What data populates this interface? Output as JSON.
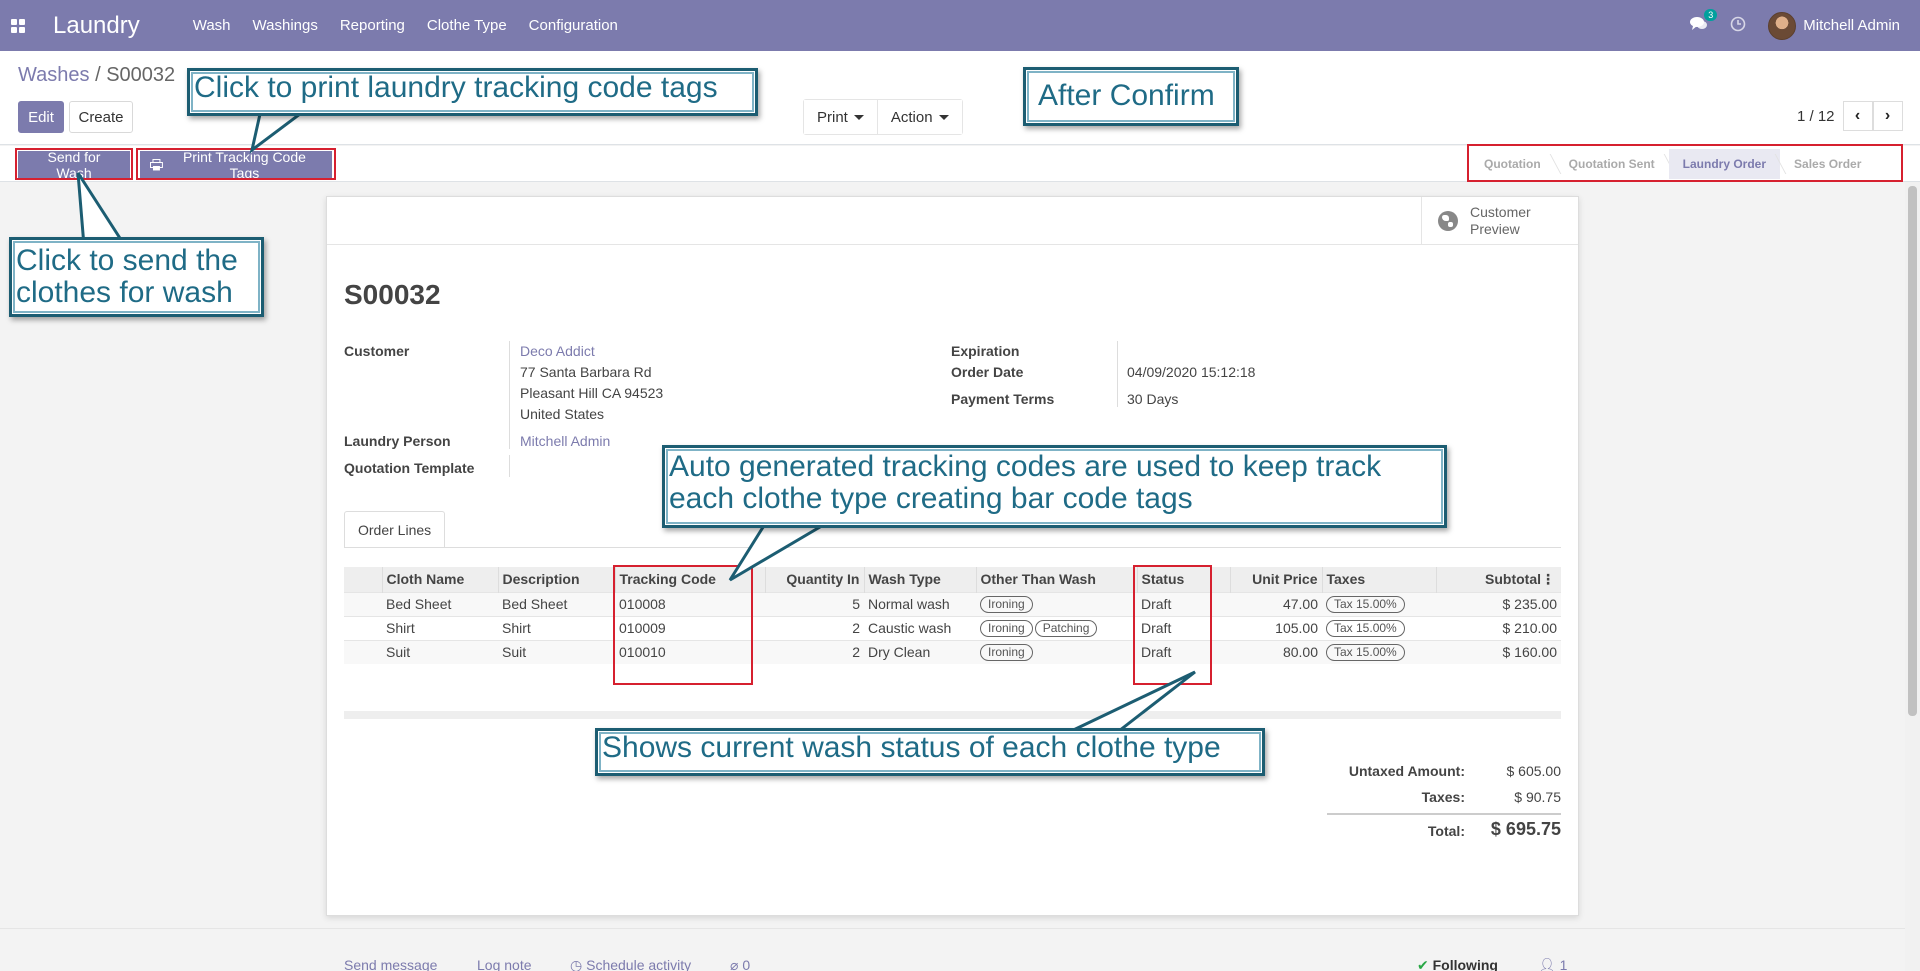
{
  "navbar": {
    "app_name": "Laundry",
    "menu": [
      "Wash",
      "Washings",
      "Reporting",
      "Clothe Type",
      "Configuration"
    ],
    "messages_count": "3",
    "user_name": "Mitchell Admin"
  },
  "breadcrumb": {
    "parent": "Washes",
    "separator": "/",
    "current": "S00032"
  },
  "buttons": {
    "edit": "Edit",
    "create": "Create",
    "print": "Print",
    "action": "Action",
    "send_for_wash": "Send for Wash",
    "print_tracking": "Print Tracking Code Tags"
  },
  "pager": {
    "value": "1 / 12"
  },
  "statusbar": {
    "stages": [
      "Quotation",
      "Quotation Sent",
      "Laundry Order",
      "Sales Order"
    ],
    "active_stage": "Laundry Order"
  },
  "sheet": {
    "customer_preview": "Customer Preview",
    "record_name": "S00032",
    "fields": {
      "customer_label": "Customer",
      "customer_name": "Deco Addict",
      "address_line1": "77 Santa Barbara Rd",
      "address_line2": "Pleasant Hill CA 94523",
      "address_line3": "United States",
      "laundry_person_label": "Laundry Person",
      "laundry_person": "Mitchell Admin",
      "quotation_template_label": "Quotation Template",
      "expiration_label": "Expiration",
      "order_date_label": "Order Date",
      "order_date": "04/09/2020 15:12:18",
      "payment_terms_label": "Payment Terms",
      "payment_terms": "30 Days"
    },
    "tabs": [
      "Order Lines"
    ],
    "table": {
      "columns": [
        "Cloth Name",
        "Description",
        "Tracking Code",
        "Quantity In",
        "Wash Type",
        "Other Than Wash",
        "Status",
        "Unit Price",
        "Taxes",
        "Subtotal"
      ],
      "rows": [
        {
          "cloth": "Bed Sheet",
          "description": "Bed Sheet",
          "code": "010008",
          "qty": "5",
          "wash": "Normal wash",
          "other": [
            "Ironing"
          ],
          "status": "Draft",
          "price": "47.00",
          "tax": "Tax 15.00%",
          "subtotal": "$ 235.00"
        },
        {
          "cloth": "Shirt",
          "description": "Shirt",
          "code": "010009",
          "qty": "2",
          "wash": "Caustic wash",
          "other": [
            "Ironing",
            "Patching"
          ],
          "status": "Draft",
          "price": "105.00",
          "tax": "Tax 15.00%",
          "subtotal": "$ 210.00"
        },
        {
          "cloth": "Suit",
          "description": "Suit",
          "code": "010010",
          "qty": "2",
          "wash": "Dry Clean",
          "other": [
            "Ironing"
          ],
          "status": "Draft",
          "price": "80.00",
          "tax": "Tax 15.00%",
          "subtotal": "$ 160.00"
        }
      ]
    },
    "totals": {
      "untaxed_label": "Untaxed Amount:",
      "untaxed": "$ 605.00",
      "taxes_label": "Taxes:",
      "taxes": "$ 90.75",
      "total_label": "Total:",
      "total": "$ 695.75"
    }
  },
  "chatter": {
    "send_message": "Send message",
    "log_note": "Log note",
    "schedule_activity": "Schedule activity",
    "attachments": "0",
    "following": "Following",
    "followers": "1"
  },
  "callouts": {
    "print_tags": "Click to print laundry tracking code tags",
    "after_confirm": "After Confirm",
    "send_wash": "Click to send the clothes for wash",
    "tracking": "Auto generated tracking codes are used to keep track each clothe type creating bar code tags",
    "status": "Shows current wash status of each clothe type"
  },
  "colors": {
    "brand": "#7c7bad",
    "highlight": "#d6202f",
    "callout_border": "#1c5d72",
    "callout_text": "#1f6b86"
  }
}
